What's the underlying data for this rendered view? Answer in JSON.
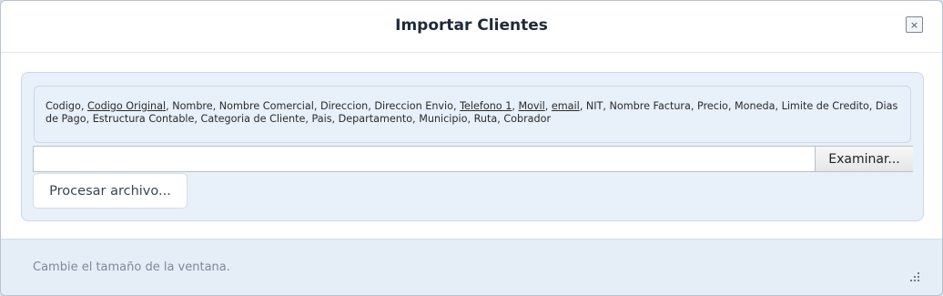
{
  "dialog": {
    "title": "Importar Clientes",
    "close_label": "×"
  },
  "import": {
    "fields": [
      {
        "text": "Codigo",
        "underline": false
      },
      {
        "text": "Codigo Original",
        "underline": true
      },
      {
        "text": "Nombre",
        "underline": false
      },
      {
        "text": "Nombre Comercial",
        "underline": false
      },
      {
        "text": "Direccion",
        "underline": false
      },
      {
        "text": "Direccion Envio",
        "underline": false
      },
      {
        "text": "Telefono 1",
        "underline": true
      },
      {
        "text": "Movil",
        "underline": true
      },
      {
        "text": "email",
        "underline": true
      },
      {
        "text": "NIT",
        "underline": false
      },
      {
        "text": "Nombre Factura",
        "underline": false
      },
      {
        "text": "Precio",
        "underline": false
      },
      {
        "text": "Moneda",
        "underline": false
      },
      {
        "text": "Limite de Credito",
        "underline": false
      },
      {
        "text": "Dias de Pago",
        "underline": false
      },
      {
        "text": "Estructura Contable",
        "underline": false
      },
      {
        "text": "Categoria de Cliente",
        "underline": false
      },
      {
        "text": "Pais",
        "underline": false
      },
      {
        "text": "Departamento",
        "underline": false
      },
      {
        "text": "Municipio",
        "underline": false
      },
      {
        "text": "Ruta",
        "underline": false
      },
      {
        "text": "Cobrador",
        "underline": false
      }
    ],
    "file_input_value": "",
    "browse_label": "Examinar...",
    "process_label": "Procesar archivo..."
  },
  "footer": {
    "status": "Cambie el tamaño de la ventana."
  },
  "icons": {
    "close": "close-icon",
    "resize": "resize-grip-icon"
  },
  "colors": {
    "panel_bg": "#e8f0fa",
    "footer_bg": "#e5edf7",
    "title_text": "#1e2a3a"
  }
}
